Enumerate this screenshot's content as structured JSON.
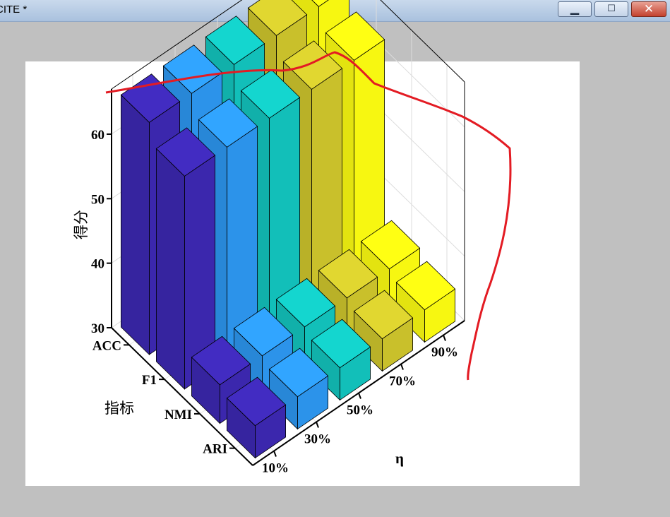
{
  "window": {
    "title": "CITE *",
    "minimize_glyph": "▁",
    "maximize_glyph": "☐",
    "close_glyph": "✕"
  },
  "chart_data": {
    "type": "bar3d",
    "title": "",
    "xlabel": "η",
    "ylabel": "指标",
    "zlabel": "得分",
    "x_categories": [
      "10%",
      "30%",
      "50%",
      "70%",
      "90%"
    ],
    "y_categories": [
      "ACC",
      "F1",
      "NMI",
      "ARI"
    ],
    "zlim": [
      30,
      67
    ],
    "zticks": [
      30,
      40,
      50,
      60
    ],
    "grid": true,
    "series_colors": [
      "#3b27ad",
      "#2c93ea",
      "#12bfb9",
      "#c9c02b",
      "#f7f711"
    ],
    "values": {
      "ACC": [
        66,
        66,
        66,
        66,
        66
      ],
      "F1": [
        63,
        63,
        63,
        63,
        63
      ],
      "NMI": [
        36,
        36,
        36,
        36,
        36
      ],
      "ARI": [
        35,
        35,
        35,
        35,
        35
      ]
    },
    "annotation": {
      "type": "red-freehand-line",
      "color": "#e31b23"
    }
  }
}
